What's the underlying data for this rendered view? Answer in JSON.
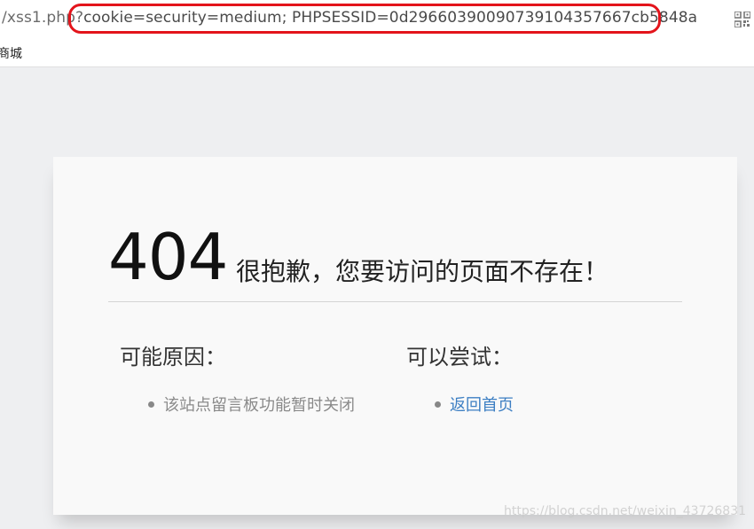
{
  "browser": {
    "url_prefix": "/xss1.php?",
    "url_query": "cookie=security=medium; PHPSESSID=0d29660390090739104357667cb5848a",
    "bookmark_label": "商城"
  },
  "error_page": {
    "code": "404",
    "headline": "很抱歉，您要访问的页面不存在！",
    "reasons_title": "可能原因：",
    "reasons": [
      "该站点留言板功能暂时关闭"
    ],
    "try_title": "可以尝试：",
    "try_links": [
      "返回首页"
    ]
  },
  "watermark": "https://blog.csdn.net/weixin_43726831",
  "colors": {
    "highlight": "#e3141b",
    "link": "#3d7fc3",
    "background": "#eeeff1",
    "card": "#f9f9f9"
  }
}
